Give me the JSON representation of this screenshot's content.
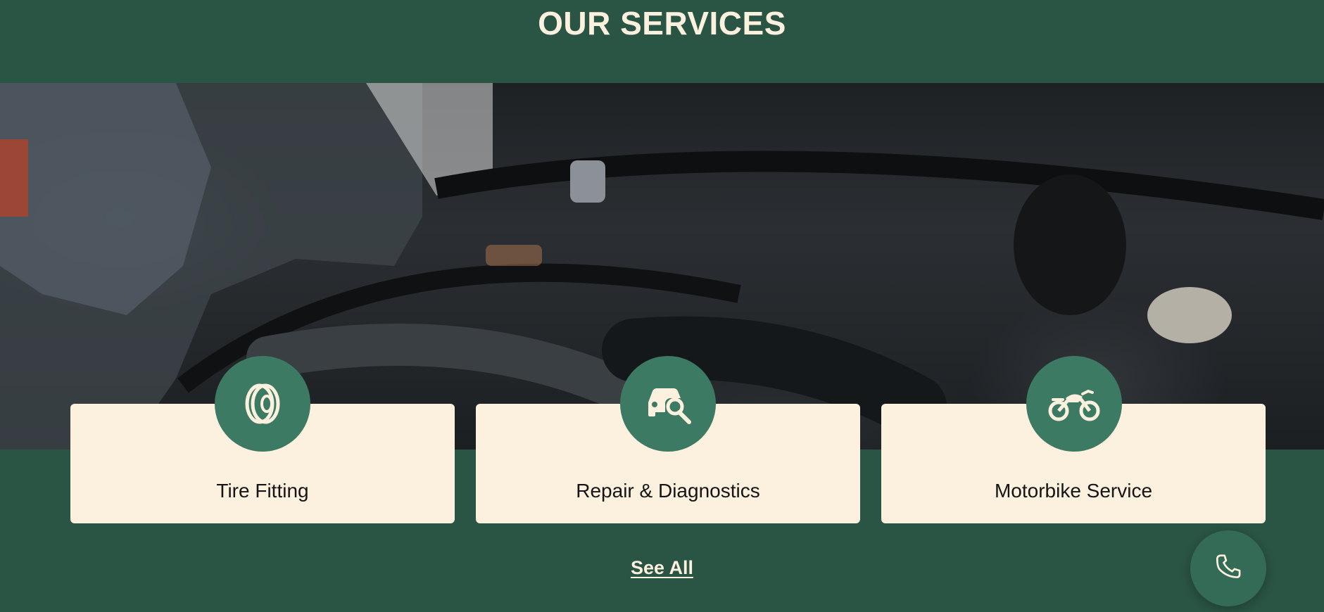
{
  "section": {
    "title": "OUR SERVICES"
  },
  "services": [
    {
      "label": "Tire Fitting",
      "icon": "tire-icon"
    },
    {
      "label": "Repair & Diagnostics",
      "icon": "car-repair-icon"
    },
    {
      "label": "Motorbike Service",
      "icon": "motorbike-icon"
    }
  ],
  "see_all": {
    "label": "See All"
  },
  "floating": {
    "icon": "phone-icon"
  },
  "colors": {
    "background": "#2a5444",
    "accent": "#3d7a63",
    "card": "#fbf1de",
    "title": "#fbf1de"
  },
  "hero_image": {
    "subject": "mechanic working in car engine bay"
  }
}
